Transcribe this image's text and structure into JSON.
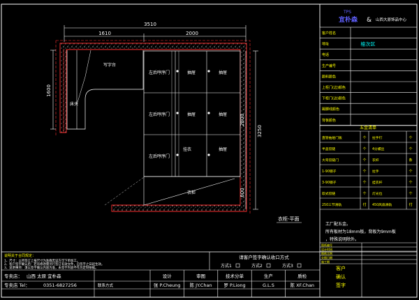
{
  "plan": {
    "dims_top": {
      "total": "3510",
      "left": "1610",
      "right": "2000"
    },
    "dims_left": "1600",
    "dims_right_upper": "2800",
    "dims_right_outer": "3250",
    "dims_right_lower": "600",
    "labels": {
      "desk": "写字台",
      "bed": "床头",
      "cabinet_door": "左后哼序门",
      "pillar": "衣柜",
      "drawer": "抽屉",
      "hanger": "挂衣",
      "view_caption": "衣柜-平面"
    },
    "cabinet_doors": [
      "左后哼序门",
      "左后哼序门",
      "左后哼序门"
    ],
    "cabinet_rows": [
      {
        "left": "抽屉",
        "right": "抽屉"
      },
      {
        "left": "抽屉",
        "right": "抽屉"
      },
      {
        "left": "挂衣",
        "right": "抽屉"
      }
    ]
  },
  "titleblock": {
    "logo_mark": "TPS",
    "brand": "宜朴森",
    "amp": "&",
    "center": "山西大原饰品中心",
    "rows": [
      {
        "label": "客户姓名",
        "value": ""
      },
      {
        "label": "地址",
        "value": "榆次区"
      },
      {
        "label": "电话",
        "value": ""
      },
      {
        "label": "生产编号",
        "value": ""
      },
      {
        "label": "颜料颜色",
        "value": ""
      },
      {
        "label": "上柜门(边)颜色",
        "value": ""
      },
      {
        "label": "下柜门(边)颜色",
        "value": ""
      },
      {
        "label": "踢脚线颜色",
        "value": ""
      },
      {
        "label": "背板颜色",
        "value": ""
      }
    ],
    "hardware_title": "五金清单",
    "hardware": [
      {
        "a": "直管抽屉门板",
        "au": "个",
        "b": "拉手钉",
        "bu": "个"
      },
      {
        "a": "半盖铰链",
        "au": "个",
        "b": "4分螺丝",
        "bu": "个"
      },
      {
        "a": "大弯铰链门",
        "au": "个",
        "b": "衣杆",
        "bu": "条"
      },
      {
        "a": "1-90钢子",
        "au": "个",
        "b": "拉手",
        "bu": "个"
      },
      {
        "a": "3-90钢子",
        "au": "个",
        "b": "挂衣杆",
        "bu": "个"
      },
      {
        "a": "软式铰链",
        "au": "个",
        "b": "灯光位",
        "bu": "个"
      },
      {
        "a": "250三节滑轨",
        "au": "付",
        "b": "450风扇滑轨",
        "bu": "付"
      }
    ],
    "notes": [
      "工厂配五金。",
      "所有板材为18mm板，背板为9mm板",
      "，特殊说明除外。"
    ],
    "signoff_rows": [
      "图纸编号",
      "设计时间",
      "图纸比例",
      "交图日期",
      "施工期"
    ],
    "customer_confirm": [
      "客户",
      "确认",
      "签字"
    ]
  },
  "footer": {
    "notes_title": "说明关于合同规定：",
    "notes": [
      "1、尺寸：以所签订上报尺寸为准确无误方可下单加工。",
      "2、客户签字确认后：若有修改需另行签订有效文件，自签字之日起生效。",
      "3、说明事项：须以签字确认内容为准，未签字内容不作为定制依据。"
    ],
    "confirm_title": "请客户签字确认收口方式",
    "options": [
      "方式1",
      "方式2",
      "方式3"
    ],
    "shop_label": "专卖店：",
    "shop_name": "山西 太原 宜朴森",
    "phone_label": "专卖店 Tel：",
    "phone": "0351-6827256",
    "shop_addr": "联系方式",
    "roles": [
      {
        "role": "设计",
        "name": "张 P.Cheung"
      },
      {
        "role": "审图",
        "name": "陈 JY.Chan"
      },
      {
        "role": "技术分单",
        "name": "罗 P.Liong"
      },
      {
        "role": "生产",
        "name": "G.L.S"
      },
      {
        "role": "质检",
        "name": "陈 XF.Chan"
      }
    ]
  }
}
